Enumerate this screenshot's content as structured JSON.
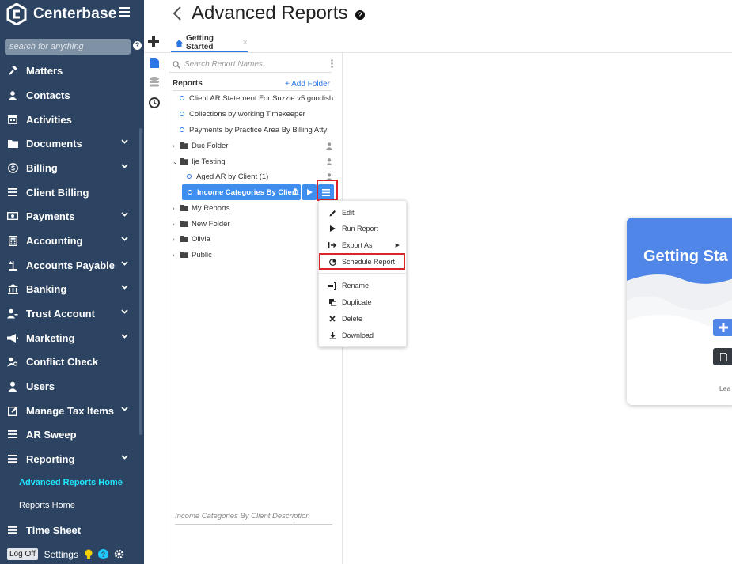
{
  "app": {
    "brand": "Centerbase"
  },
  "sidebar": {
    "search_placeholder": "search for anything",
    "search_help": "?",
    "items": [
      {
        "label": "Matters",
        "icon": "gavel-icon",
        "chevron": false
      },
      {
        "label": "Contacts",
        "icon": "contact-icon",
        "chevron": false
      },
      {
        "label": "Activities",
        "icon": "calendar-icon",
        "chevron": false
      },
      {
        "label": "Documents",
        "icon": "folder-icon",
        "chevron": true
      },
      {
        "label": "Billing",
        "icon": "dollar-icon",
        "chevron": true
      },
      {
        "label": "Client Billing",
        "icon": "list-icon",
        "chevron": false
      },
      {
        "label": "Payments",
        "icon": "money-icon",
        "chevron": true
      },
      {
        "label": "Accounting",
        "icon": "calculator-icon",
        "chevron": true
      },
      {
        "label": "Accounts Payable",
        "icon": "scale-icon",
        "chevron": true
      },
      {
        "label": "Banking",
        "icon": "bank-icon",
        "chevron": true
      },
      {
        "label": "Trust Account",
        "icon": "user-key-icon",
        "chevron": true
      },
      {
        "label": "Marketing",
        "icon": "megaphone-icon",
        "chevron": true
      },
      {
        "label": "Conflict Check",
        "icon": "user-search-icon",
        "chevron": false
      },
      {
        "label": "Users",
        "icon": "user-icon",
        "chevron": false
      },
      {
        "label": "Manage Tax Items",
        "icon": "edit-icon",
        "chevron": true
      },
      {
        "label": "AR Sweep",
        "icon": "list-icon",
        "chevron": false
      },
      {
        "label": "Reporting",
        "icon": "list-icon",
        "chevron": true
      }
    ],
    "sub_items": [
      "Advanced Reports Home",
      "Reports Home"
    ],
    "last_item": {
      "label": "Time Sheet",
      "icon": "list-icon"
    },
    "footer": {
      "logoff": "Log Off",
      "settings": "Settings"
    }
  },
  "header": {
    "title": "Advanced Reports",
    "help": "?"
  },
  "tabs": [
    {
      "label": "Getting Started",
      "close": "×"
    }
  ],
  "tree": {
    "search_placeholder": "Search Report Names.",
    "section_label": "Reports",
    "add_folder": "+ Add Folder",
    "top_reports": [
      "Client AR Statement For Suzzie v5 goodish",
      "Collections by working Timekeeper",
      "Payments by Practice Area By Billing Atty"
    ],
    "folders_before": [
      {
        "label": "Duc Folder",
        "expanded": false
      },
      {
        "label": "Ije Testing",
        "expanded": true
      }
    ],
    "child_reports": [
      "Aged AR by Client (1)"
    ],
    "selected_report": "Income Categories By Client",
    "folders_after": [
      "My Reports",
      "New Folder",
      "Olivia",
      "Public"
    ],
    "description_placeholder": "Income Categories By Client Description"
  },
  "context_menu": {
    "items": [
      {
        "label": "Edit",
        "icon": "pencil-icon"
      },
      {
        "label": "Run Report",
        "icon": "play-icon"
      },
      {
        "label": "Export As",
        "icon": "export-icon",
        "submenu": true
      },
      {
        "label": "Schedule Report",
        "icon": "pie-clock-icon",
        "highlighted": true
      },
      {
        "label": "Rename",
        "icon": "rename-icon"
      },
      {
        "label": "Duplicate",
        "icon": "copy-icon"
      },
      {
        "label": "Delete",
        "icon": "x-icon"
      },
      {
        "label": "Download",
        "icon": "download-icon"
      }
    ],
    "submenu_arrow": "▶"
  },
  "card": {
    "title": "Getting Sta",
    "learn": "Lea"
  },
  "colors": {
    "sidebar_bg": "#2c4461",
    "accent": "#3e8ef0",
    "active_sub": "#1fe6ff",
    "highlight_box": "#d9252a",
    "card_blue": "#4f86e7"
  }
}
